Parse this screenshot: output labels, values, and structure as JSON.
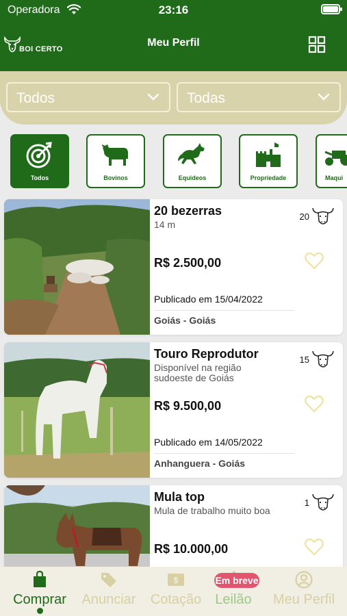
{
  "status_bar": {
    "carrier": "Operadora",
    "time": "23:16"
  },
  "header": {
    "title": "Meu Perfil",
    "logo_text": "BOI CERTO"
  },
  "filters": {
    "first": "Todos",
    "second": "Todas"
  },
  "categories": [
    {
      "label": "Todos",
      "icon": "target-icon",
      "active": true
    },
    {
      "label": "Bovinos",
      "icon": "cow-icon",
      "active": false
    },
    {
      "label": "Equideos",
      "icon": "horse-icon",
      "active": false
    },
    {
      "label": "Propriedade",
      "icon": "farm-icon",
      "active": false
    },
    {
      "label": "Maqui",
      "icon": "machine-icon",
      "active": false
    }
  ],
  "listings": [
    {
      "title": "20 bezerras",
      "subtitle": "14 m",
      "price": "R$  2.500,00",
      "published": "Publicado em 15/04/2022",
      "location": "Goiás - Goiás",
      "count": "20",
      "image": "herd-photo"
    },
    {
      "title": "Touro Reprodutor",
      "subtitle": "Disponível na região sudoeste de Goiás",
      "price": "R$  9.500,00",
      "published": "Publicado em 14/05/2022",
      "location": "Anhanguera - Goiás",
      "count": "15",
      "image": "bull-photo"
    },
    {
      "title": "Mula top",
      "subtitle": "Mula de trabalho muito boa",
      "price": "R$  10.000,00",
      "published": "",
      "location": "",
      "count": "1",
      "image": "mule-photo"
    }
  ],
  "tabs": [
    {
      "label": "Comprar",
      "icon": "shopping-bag-icon",
      "active": true
    },
    {
      "label": "Anunciar",
      "icon": "tag-icon",
      "active": false
    },
    {
      "label": "Cotação",
      "icon": "money-icon",
      "active": false
    },
    {
      "label": "Leilão",
      "icon": "gavel-icon",
      "active": false,
      "badge": "Em breve"
    },
    {
      "label": "Meu Perfil",
      "icon": "user-circle-icon",
      "active": false
    }
  ],
  "colors": {
    "primary": "#1f6b1a",
    "filter_bg": "#d9d3ab",
    "heart": "#f0e2a0",
    "badge": "#e2556f",
    "inactive_tab": "#d8cfa3"
  }
}
